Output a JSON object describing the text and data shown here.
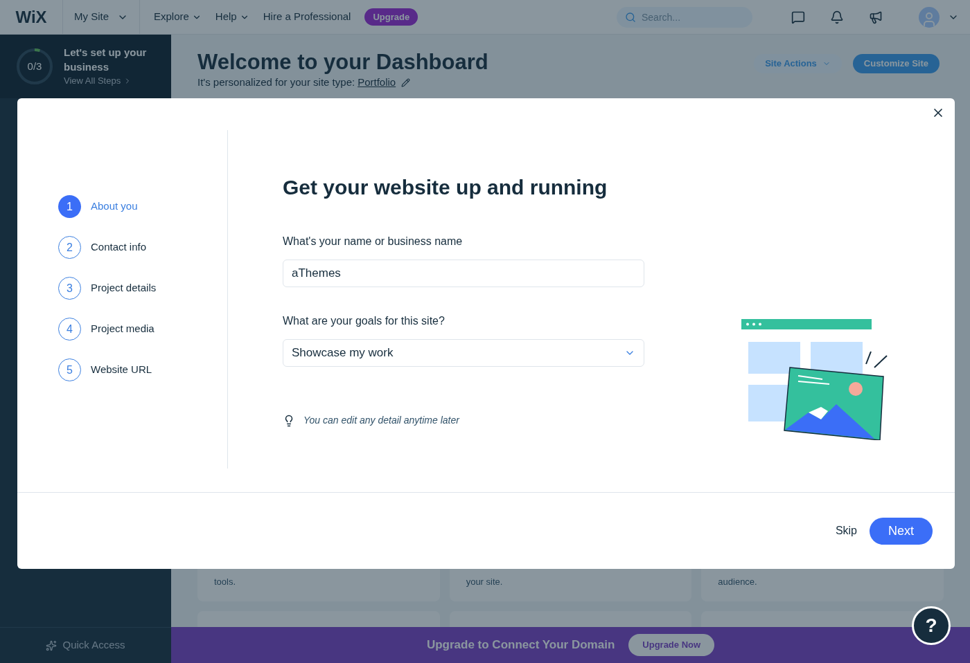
{
  "top_bar": {
    "logo": "WiX",
    "site_menu": "My Site",
    "nav": [
      "Explore",
      "Help"
    ],
    "hire_link": "Hire a Professional",
    "upgrade_badge": "Upgrade",
    "search": {
      "placeholder": "Search..."
    }
  },
  "sidebar": {
    "setup": {
      "progress": "0/3",
      "level": 0.05,
      "title": "Let's set up your business",
      "link": "View All Steps"
    },
    "quick_access": "Quick Access"
  },
  "dashboard": {
    "title": "Welcome to your Dashboard",
    "subtitle": "It's personalized for your site type:",
    "site_type": "Portfolio",
    "site_actions": "Site Actions",
    "customize": "Customize Site",
    "cards": [
      {
        "text": "tools."
      },
      {
        "text": "your site."
      },
      {
        "text": "audience."
      }
    ],
    "banner": {
      "text": "Upgrade to Connect Your Domain",
      "button": "Upgrade Now"
    },
    "help": "?"
  },
  "dialog": {
    "steps": [
      {
        "number": "1",
        "label": "About you",
        "selected": true
      },
      {
        "number": "2",
        "label": "Contact info",
        "selected": false
      },
      {
        "number": "3",
        "label": "Project details",
        "selected": false
      },
      {
        "number": "4",
        "label": "Project media",
        "selected": false
      },
      {
        "number": "5",
        "label": "Website URL",
        "selected": false
      }
    ],
    "title": "Get your website up and running",
    "name_label": "What's your name or business name",
    "name_value": "aThemes",
    "goals_label": "What are your goals for this site?",
    "goals_value": "Showcase my work",
    "tip": "You can edit any detail anytime later",
    "skip": "Skip",
    "next": "Next"
  }
}
